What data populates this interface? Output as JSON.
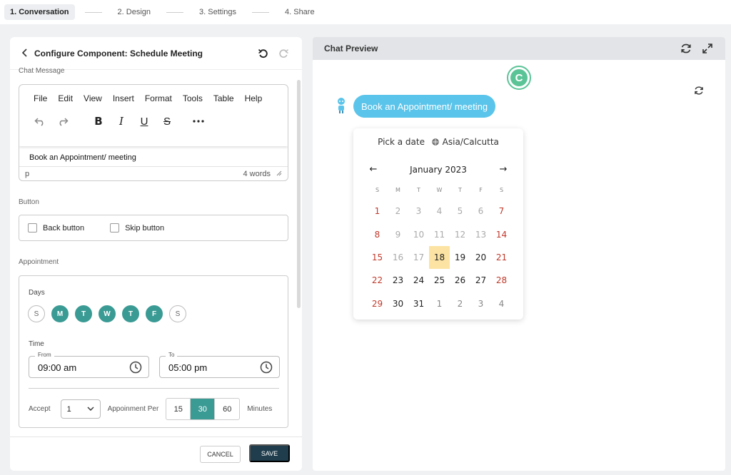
{
  "stepper": {
    "steps": [
      {
        "label": "1. Conversation",
        "active": true
      },
      {
        "label": "2. Design",
        "active": false
      },
      {
        "label": "3. Settings",
        "active": false
      },
      {
        "label": "4. Share",
        "active": false
      }
    ]
  },
  "left_panel": {
    "title": "Configure Component: Schedule Meeting",
    "chat_message_label": "Chat Message",
    "editor": {
      "menu": [
        "File",
        "Edit",
        "View",
        "Insert",
        "Format",
        "Tools",
        "Table",
        "Help"
      ],
      "content": "Book an Appointment/ meeting",
      "status_tag": "p",
      "word_count": "4 words"
    },
    "button_section": {
      "label": "Button",
      "back_label": "Back button",
      "skip_label": "Skip button"
    },
    "appointment": {
      "label": "Appointment",
      "days_label": "Days",
      "days": [
        {
          "label": "S",
          "on": false
        },
        {
          "label": "M",
          "on": true
        },
        {
          "label": "T",
          "on": true
        },
        {
          "label": "W",
          "on": true
        },
        {
          "label": "T",
          "on": true
        },
        {
          "label": "F",
          "on": true
        },
        {
          "label": "S",
          "on": false
        }
      ],
      "time_label": "Time",
      "from_caption": "From",
      "from_value": "09:00 am",
      "to_caption": "To",
      "to_value": "05:00 pm",
      "accept_label": "Accept",
      "accept_value": "1",
      "per_label": "Appoinment Per",
      "durations": [
        {
          "label": "15",
          "selected": false
        },
        {
          "label": "30",
          "selected": true
        },
        {
          "label": "60",
          "selected": false
        }
      ],
      "minutes_label": "Minutes"
    },
    "footer": {
      "cancel_label": "CANCEL",
      "save_label": "SAVE"
    }
  },
  "chat_preview": {
    "title": "Chat Preview",
    "logo_letter": "C",
    "bubble_text": "Book an Appointment/ meeting",
    "calendar": {
      "pick_label": "Pick a date",
      "timezone": "Asia/Calcutta",
      "month_label": "January 2023",
      "prev_arrow": "←",
      "next_arrow": "→",
      "weekday_headers": [
        "S",
        "M",
        "T",
        "W",
        "T",
        "F",
        "S"
      ],
      "days": [
        {
          "d": "1",
          "t": "wk"
        },
        {
          "d": "2",
          "t": "off"
        },
        {
          "d": "3",
          "t": "off"
        },
        {
          "d": "4",
          "t": "off"
        },
        {
          "d": "5",
          "t": "off"
        },
        {
          "d": "6",
          "t": "off"
        },
        {
          "d": "7",
          "t": "wk"
        },
        {
          "d": "8",
          "t": "wk"
        },
        {
          "d": "9",
          "t": "off"
        },
        {
          "d": "10",
          "t": "off"
        },
        {
          "d": "11",
          "t": "off"
        },
        {
          "d": "12",
          "t": "off"
        },
        {
          "d": "13",
          "t": "off"
        },
        {
          "d": "14",
          "t": "wk"
        },
        {
          "d": "15",
          "t": "wk"
        },
        {
          "d": "16",
          "t": "off"
        },
        {
          "d": "17",
          "t": "off"
        },
        {
          "d": "18",
          "t": "today"
        },
        {
          "d": "19",
          "t": "n"
        },
        {
          "d": "20",
          "t": "n"
        },
        {
          "d": "21",
          "t": "wk"
        },
        {
          "d": "22",
          "t": "wk"
        },
        {
          "d": "23",
          "t": "n"
        },
        {
          "d": "24",
          "t": "n"
        },
        {
          "d": "25",
          "t": "n"
        },
        {
          "d": "26",
          "t": "n"
        },
        {
          "d": "27",
          "t": "n"
        },
        {
          "d": "28",
          "t": "wk"
        },
        {
          "d": "29",
          "t": "wk"
        },
        {
          "d": "30",
          "t": "n"
        },
        {
          "d": "31",
          "t": "n"
        },
        {
          "d": "1",
          "t": "muted"
        },
        {
          "d": "2",
          "t": "muted"
        },
        {
          "d": "3",
          "t": "muted"
        },
        {
          "d": "4",
          "t": "muted"
        }
      ]
    }
  },
  "colors": {
    "accent_teal": "#3a9a94",
    "save_navy": "#1f3d4d",
    "bubble_blue": "#5bc4ea",
    "logo_green": "#5bc497",
    "weekend_red": "#c0392b",
    "today_highlight": "#fce3a3"
  },
  "icons": {
    "back": "chevron-left-icon",
    "undo": "undo-icon",
    "redo": "redo-icon",
    "refresh": "refresh-icon",
    "expand": "expand-icon",
    "clock": "clock-icon",
    "globe": "globe-icon",
    "more": "more-horizontal-icon"
  }
}
